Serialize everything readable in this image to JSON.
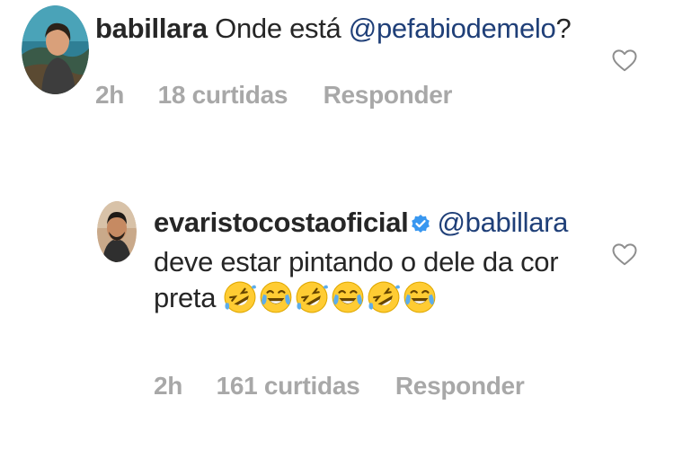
{
  "comments": [
    {
      "username": "babillara",
      "text": "Onde está ",
      "mention": "@pefabiodemelo",
      "after": "?",
      "time": "2h",
      "likes": "18 curtidas",
      "reply": "Responder"
    },
    {
      "username": "evaristocostaoficial",
      "verified": true,
      "mention": "@babillara",
      "text_line1": "deve estar pintando o dele da cor",
      "text_line2": "preta ",
      "emojis": [
        "rolling-laughing",
        "tears-of-joy",
        "rolling-laughing",
        "tears-of-joy",
        "rolling-laughing",
        "tears-of-joy"
      ],
      "time": "2h",
      "likes": "161 curtidas",
      "reply": "Responder"
    }
  ],
  "colors": {
    "text": "#262626",
    "mention": "#1f3f78",
    "meta": "#a8a8a8",
    "verified": "#3897f0",
    "heart": "#8e8e8e"
  }
}
